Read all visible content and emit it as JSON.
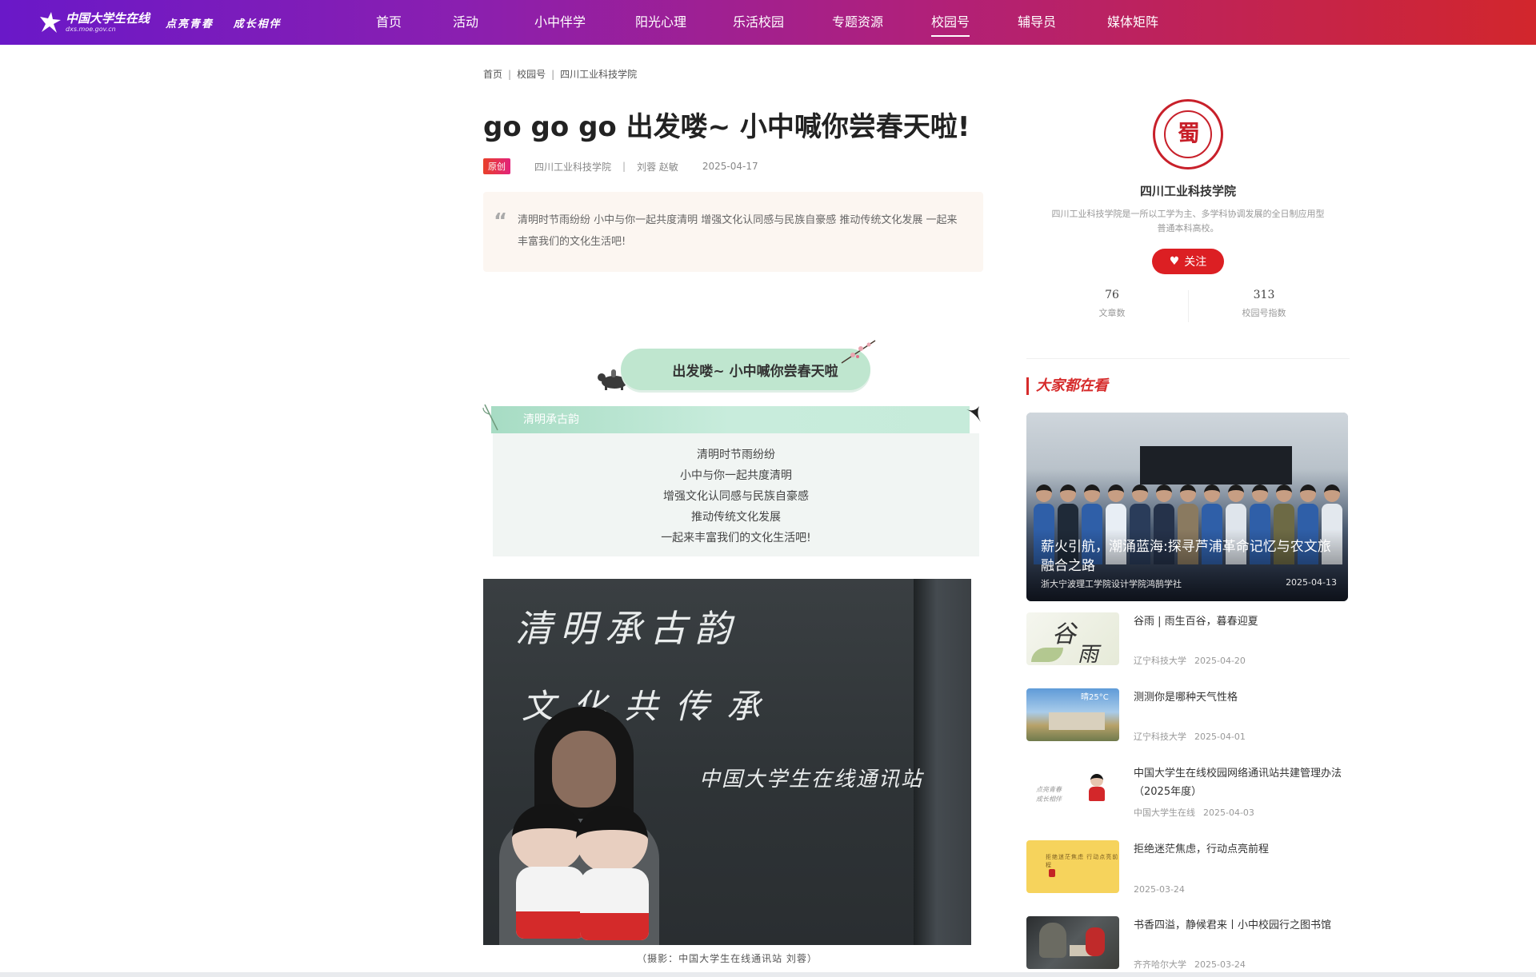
{
  "header": {
    "logo_name": "中国大学生在线",
    "logo_url": "dxs.moe.gov.cn",
    "slogan": [
      "点亮青春",
      "成长相伴"
    ],
    "nav": [
      {
        "label": "首页",
        "active": false
      },
      {
        "label": "活动",
        "active": false
      },
      {
        "label": "小中伴学",
        "active": false
      },
      {
        "label": "阳光心理",
        "active": false
      },
      {
        "label": "乐活校园",
        "active": false
      },
      {
        "label": "专题资源",
        "active": false
      },
      {
        "label": "校园号",
        "active": true
      },
      {
        "label": "辅导员",
        "active": false
      },
      {
        "label": "媒体矩阵",
        "active": false
      }
    ]
  },
  "breadcrumb": [
    "首页",
    "校园号",
    "四川工业科技学院"
  ],
  "article": {
    "title": "go go go 出发喽~ 小中喊你尝春天啦!",
    "badge": "原创",
    "source": "四川工业科技学院",
    "authors": "刘蓉 赵敏",
    "date": "2025-04-17",
    "quote_mark": "“",
    "summary": "清明时节雨纷纷 小中与你一起共度清明 增强文化认同感与民族自豪感 推动传统文化发展 一起来丰富我们的文化生活吧!",
    "banner_text": "出发喽~ 小中喊你尝春天啦",
    "section_tab": "清明承古韵",
    "section_lines": [
      "清明时节雨纷纷",
      "小中与你一起共度清明",
      "增强文化认同感与民族自豪感",
      "推动传统文化发展",
      "一起来丰富我们的文化生活吧!"
    ],
    "photo_chalk": [
      "清明承古韵",
      "文化共传承",
      "中国大学生在线通讯站"
    ],
    "photo_caption": "（摄影：中国大学生在线通讯站 刘蓉）"
  },
  "profile": {
    "logo_char": "蜀",
    "name": "四川工业科技学院",
    "description": "四川工业科技学院是一所以工学为主、多学科协调发展的全日制应用型普通本科高校。",
    "follow_label": "关注",
    "stats": [
      {
        "value": "76",
        "label": "文章数"
      },
      {
        "value": "313",
        "label": "校园号指数"
      }
    ]
  },
  "hot": {
    "title": "大家都在看",
    "featured": {
      "title": "薪火引航，潮涌蓝海:探寻芦浦革命记忆与农文旅融合之路",
      "source": "浙大宁波理工学院设计学院鸿鹄学社",
      "date": "2025-04-13"
    },
    "items": [
      {
        "title": "谷雨 | 雨生百谷，暮春迎夏",
        "source": "辽宁科技大学",
        "date": "2025-04-20",
        "thumb_chars": [
          "谷",
          "雨"
        ]
      },
      {
        "title": "测测你是哪种天气性格",
        "source": "辽宁科技大学",
        "date": "2025-04-01",
        "thumb_chars": [
          "晴25°C"
        ]
      },
      {
        "title": "中国大学生在线校园网络通讯站共建管理办法（2025年度）",
        "source": "中国大学生在线",
        "date": "2025-04-03",
        "thumb_chars": [
          "点亮青春",
          "成长相伴"
        ]
      },
      {
        "title": "拒绝迷茫焦虑，行动点亮前程",
        "source": "",
        "date": "2025-03-24",
        "thumb_chars": [
          "拒绝迷茫焦虑 行动点亮前程"
        ]
      },
      {
        "title": "书香四溢，静候君来丨小中校园行之图书馆",
        "source": "齐齐哈尔大学",
        "date": "2025-03-24",
        "thumb_chars": []
      }
    ]
  },
  "colors": {
    "header_start": "#6a18c8",
    "header_end": "#d2262c",
    "accent_red": "#dc1f23",
    "banner_green": "#bfe6cf",
    "quote_bg": "#fcf6f1"
  }
}
